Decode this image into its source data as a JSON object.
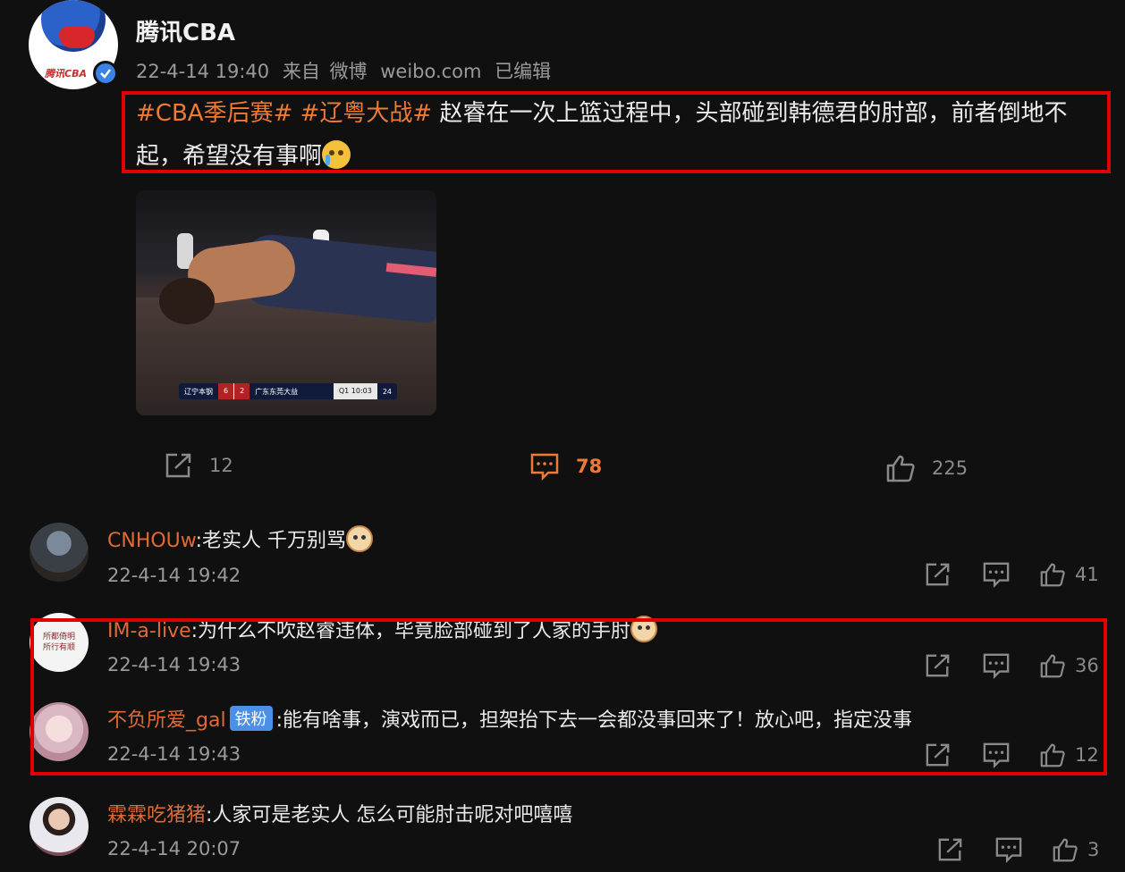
{
  "post": {
    "author": "腾讯CBA",
    "avatar_logo_text": "腾讯CBA",
    "date": "22-4-14 19:40",
    "source_prefix": "来自",
    "source_app": "微博",
    "source_site": "weibo.com",
    "edited": "已编辑",
    "hashtag1": "#CBA季后赛#",
    "hashtag2": "#辽粤大战#",
    "text": "赵睿在一次上篮过程中，头部碰到韩德君的肘部，前者倒地不起，希望没有事啊",
    "image": {
      "team_home": "辽宁本钢",
      "score_home": "6",
      "score_away": "2",
      "team_away": "广东东莞大益",
      "clock": "Q1 10:03",
      "shot_clock": "24"
    },
    "actions": {
      "share_count": "12",
      "comment_count": "78",
      "like_count": "225"
    }
  },
  "comments": [
    {
      "name": "CNHOUw",
      "badge": "",
      "text": ":老实人 千万别骂",
      "time": "22-4-14 19:42",
      "likes": "41"
    },
    {
      "name": "IM-a-live",
      "badge": "",
      "text": ":为什么不吹赵睿违体，毕竟脸部碰到了人家的手肘",
      "time": "22-4-14 19:43",
      "likes": "36",
      "avatar_text": "所都倚明 所行有顺"
    },
    {
      "name": "不负所爱_gal",
      "badge": "铁粉",
      "text": ":能有啥事，演戏而已，担架抬下去一会都没事回来了！放心吧，指定没事",
      "time": "22-4-14 19:43",
      "likes": "12"
    },
    {
      "name": "霖霖吃猪猪",
      "badge": "",
      "text": ":人家可是老实人 怎么可能肘击呢对吧嘻嘻",
      "time": "22-4-14 20:07",
      "likes": "3"
    }
  ],
  "colors": {
    "accent": "#f07a35",
    "highlight_box": "#e00000",
    "background": "#101010"
  }
}
